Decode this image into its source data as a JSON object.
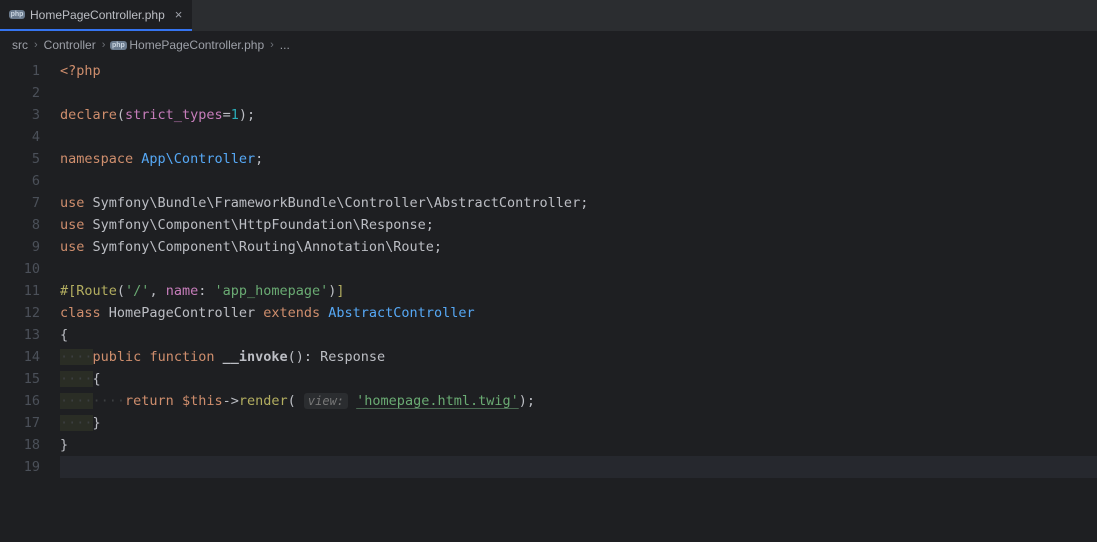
{
  "tab": {
    "filename": "HomePageController.php",
    "close_icon": "×"
  },
  "breadcrumb": {
    "parts": [
      "src",
      "Controller",
      "HomePageController.php",
      "..."
    ]
  },
  "gutter": {
    "start": 1,
    "end": 19
  },
  "code": {
    "lines": [
      {
        "n": 1,
        "segs": [
          {
            "t": "<?php",
            "c": "kw"
          }
        ]
      },
      {
        "n": 2,
        "segs": []
      },
      {
        "n": 3,
        "segs": [
          {
            "t": "declare",
            "c": "kw"
          },
          {
            "t": "(",
            "c": "punc"
          },
          {
            "t": "strict_types",
            "c": "route"
          },
          {
            "t": "=",
            "c": "punc"
          },
          {
            "t": "1",
            "c": "num"
          },
          {
            "t": ");",
            "c": "punc"
          }
        ]
      },
      {
        "n": 4,
        "segs": []
      },
      {
        "n": 5,
        "segs": [
          {
            "t": "namespace",
            "c": "kw"
          },
          {
            "t": " ",
            "c": ""
          },
          {
            "t": "App\\Controller",
            "c": "extends-cls"
          },
          {
            "t": ";",
            "c": "punc"
          }
        ]
      },
      {
        "n": 6,
        "segs": []
      },
      {
        "n": 7,
        "segs": [
          {
            "t": "use",
            "c": "kw"
          },
          {
            "t": " ",
            "c": ""
          },
          {
            "t": "Symfony\\Bundle\\FrameworkBundle\\Controller\\AbstractController",
            "c": "ns"
          },
          {
            "t": ";",
            "c": "punc"
          }
        ]
      },
      {
        "n": 8,
        "segs": [
          {
            "t": "use",
            "c": "kw"
          },
          {
            "t": " ",
            "c": ""
          },
          {
            "t": "Symfony\\Component\\HttpFoundation\\Response",
            "c": "ns"
          },
          {
            "t": ";",
            "c": "punc"
          }
        ]
      },
      {
        "n": 9,
        "segs": [
          {
            "t": "use",
            "c": "kw"
          },
          {
            "t": " ",
            "c": ""
          },
          {
            "t": "Symfony\\Component\\Routing\\Annotation\\Route",
            "c": "ns"
          },
          {
            "t": ";",
            "c": "punc"
          }
        ]
      },
      {
        "n": 10,
        "segs": []
      },
      {
        "n": 11,
        "segs": [
          {
            "t": "#[",
            "c": "attr"
          },
          {
            "t": "Route",
            "c": "attr"
          },
          {
            "t": "(",
            "c": "punc"
          },
          {
            "t": "'/'",
            "c": "str"
          },
          {
            "t": ", ",
            "c": "punc"
          },
          {
            "t": "name",
            "c": "route"
          },
          {
            "t": ": ",
            "c": "punc"
          },
          {
            "t": "'app_homepage'",
            "c": "str"
          },
          {
            "t": ")",
            "c": "punc"
          },
          {
            "t": "]",
            "c": "attr"
          }
        ]
      },
      {
        "n": 12,
        "segs": [
          {
            "t": "class",
            "c": "kw"
          },
          {
            "t": " ",
            "c": ""
          },
          {
            "t": "HomePageController",
            "c": "cls"
          },
          {
            "t": " ",
            "c": ""
          },
          {
            "t": "extends",
            "c": "kw"
          },
          {
            "t": " ",
            "c": ""
          },
          {
            "t": "AbstractController",
            "c": "extends-cls"
          }
        ]
      },
      {
        "n": 13,
        "segs": [
          {
            "t": "{",
            "c": "punc"
          }
        ]
      },
      {
        "n": 14,
        "segs": [
          {
            "t": "····",
            "c": "ws indent-bg"
          },
          {
            "t": "public",
            "c": "kw"
          },
          {
            "t": " ",
            "c": ""
          },
          {
            "t": "function",
            "c": "kw"
          },
          {
            "t": " ",
            "c": ""
          },
          {
            "t": "__invoke",
            "c": "fn method-bold"
          },
          {
            "t": "(): ",
            "c": "punc"
          },
          {
            "t": "Response",
            "c": "cls"
          }
        ]
      },
      {
        "n": 15,
        "segs": [
          {
            "t": "····",
            "c": "ws indent-bg"
          },
          {
            "t": "{",
            "c": "punc"
          }
        ]
      },
      {
        "n": 16,
        "segs": [
          {
            "t": "····",
            "c": "ws indent-bg"
          },
          {
            "t": "····",
            "c": "ws"
          },
          {
            "t": "return",
            "c": "kw"
          },
          {
            "t": " ",
            "c": ""
          },
          {
            "t": "$this",
            "c": "kw"
          },
          {
            "t": "->",
            "c": "punc"
          },
          {
            "t": "render",
            "c": "attr"
          },
          {
            "t": "( ",
            "c": "punc"
          },
          {
            "t": "view:",
            "c": "param-hint"
          },
          {
            "t": " ",
            "c": ""
          },
          {
            "t": "'homepage.html.twig'",
            "c": "link-str"
          },
          {
            "t": ");",
            "c": "punc"
          }
        ]
      },
      {
        "n": 17,
        "segs": [
          {
            "t": "····",
            "c": "ws indent-bg"
          },
          {
            "t": "}",
            "c": "punc"
          }
        ]
      },
      {
        "n": 18,
        "segs": [
          {
            "t": "}",
            "c": "punc"
          }
        ]
      },
      {
        "n": 19,
        "segs": [],
        "hl": true
      }
    ]
  }
}
